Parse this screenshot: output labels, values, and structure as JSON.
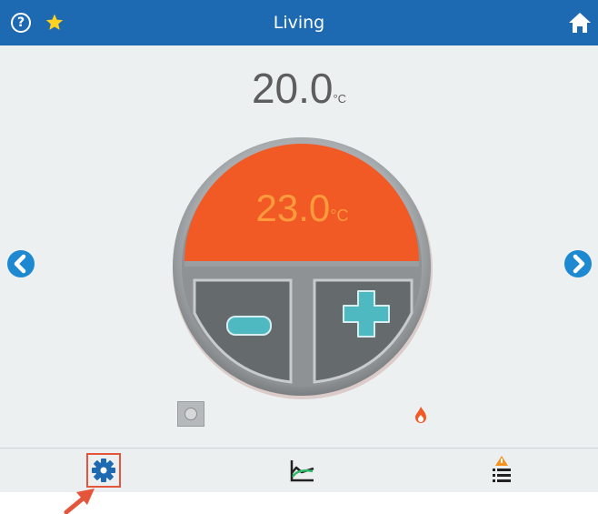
{
  "header": {
    "title": "Living",
    "help_icon": "question-circle-icon",
    "favorite_icon": "star-icon",
    "home_icon": "home-icon"
  },
  "current_temperature": {
    "value": "20.0",
    "unit": "°C"
  },
  "setpoint": {
    "value": "23.0",
    "unit": "°C"
  },
  "controls": {
    "decrease_icon": "minus-icon",
    "increase_icon": "plus-icon",
    "prev_icon": "chevron-left-icon",
    "next_icon": "chevron-right-icon"
  },
  "status": {
    "mode_icon": "mode-indicator-icon",
    "heating_icon": "flame-icon"
  },
  "toolbar": {
    "settings_icon": "gear-icon",
    "graph_icon": "graph-icon",
    "alarm_icon": "alarm-list-icon"
  },
  "colors": {
    "header": "#1d6ab3",
    "accent_blue": "#1e88d0",
    "setpoint_orange": "#f15a24",
    "setpoint_text": "#ff9a3d",
    "plus_minus": "#4fb9c2",
    "highlight_red": "#e4553c"
  }
}
